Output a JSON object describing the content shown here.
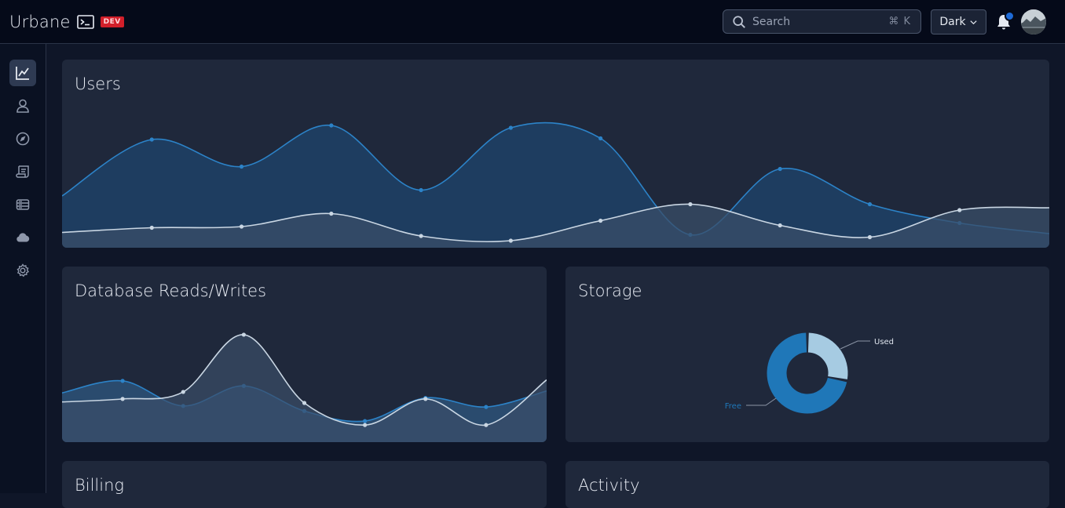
{
  "app": {
    "name": "Urbane",
    "env_badge": "DEV"
  },
  "header": {
    "search": {
      "placeholder": "Search",
      "shortcut": "⌘ K"
    },
    "theme": {
      "label": "Dark"
    },
    "notifications": {
      "unread": true
    },
    "icons": {
      "terminal": "terminal-icon",
      "search": "search-icon",
      "chevron": "chevron-down-icon",
      "bell": "bell-icon"
    }
  },
  "sidebar": {
    "items": [
      {
        "name": "analytics",
        "icon": "chart-line-icon",
        "active": true
      },
      {
        "name": "users",
        "icon": "user-icon",
        "active": false
      },
      {
        "name": "explore",
        "icon": "compass-icon",
        "active": false
      },
      {
        "name": "scripts",
        "icon": "scroll-icon",
        "active": false
      },
      {
        "name": "database",
        "icon": "server-icon",
        "active": false
      },
      {
        "name": "cloud",
        "icon": "cloud-icon",
        "active": false
      },
      {
        "name": "settings",
        "icon": "gear-icon",
        "active": false
      }
    ]
  },
  "cards": {
    "users": {
      "title": "Users"
    },
    "db": {
      "title": "Database Reads/Writes"
    },
    "storage": {
      "title": "Storage"
    },
    "billing": {
      "title": "Billing"
    },
    "activity": {
      "title": "Activity"
    }
  },
  "colors": {
    "primary_series": "#2c83c8",
    "secondary_series": "#c9d6e3",
    "used": "#a6cbe2",
    "free": "#1f77b8"
  },
  "chart_data": [
    {
      "type": "area",
      "title": "Users",
      "ylim": [
        0,
        100
      ],
      "series": [
        {
          "values": [
            40,
            88,
            65,
            100,
            45,
            98,
            89,
            7,
            63,
            33,
            17,
            8
          ]
        },
        {
          "values": [
            9,
            13,
            14,
            25,
            6,
            2,
            19,
            33,
            15,
            5,
            28,
            30
          ]
        }
      ]
    },
    {
      "type": "area",
      "title": "Database Reads/Writes",
      "ylim": [
        0,
        100
      ],
      "series": [
        {
          "values": [
            35,
            47,
            22,
            42,
            17,
            7,
            30,
            21,
            37
          ]
        },
        {
          "values": [
            26,
            29,
            36,
            93,
            25,
            3,
            29,
            3,
            48
          ]
        }
      ]
    },
    {
      "type": "pie",
      "title": "Storage",
      "categories": [
        "Used",
        "Free"
      ],
      "values": [
        28,
        72
      ]
    }
  ]
}
